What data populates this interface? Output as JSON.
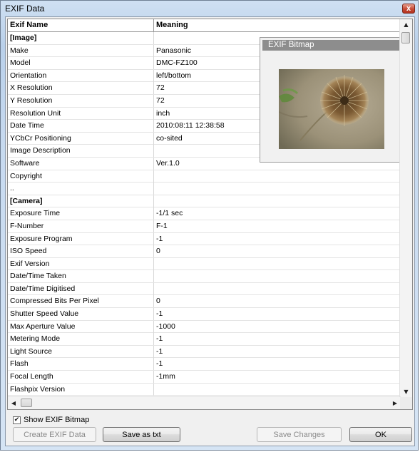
{
  "window": {
    "title": "EXIF Data",
    "close_glyph": "x"
  },
  "table": {
    "headers": {
      "name": "Exif Name",
      "meaning": "Meaning"
    },
    "rows": [
      {
        "name": "[Image]",
        "value": "",
        "section": true
      },
      {
        "name": "Make",
        "value": "Panasonic"
      },
      {
        "name": "Model",
        "value": "DMC-FZ100"
      },
      {
        "name": "Orientation",
        "value": "left/bottom"
      },
      {
        "name": "X Resolution",
        "value": "72"
      },
      {
        "name": "Y Resolution",
        "value": "72"
      },
      {
        "name": "Resolution Unit",
        "value": "inch"
      },
      {
        "name": "Date Time",
        "value": "2010:08:11 12:38:58"
      },
      {
        "name": "YCbCr Positioning",
        "value": "co-sited"
      },
      {
        "name": "Image Description",
        "value": ""
      },
      {
        "name": "Software",
        "value": "Ver.1.0"
      },
      {
        "name": "Copyright",
        "value": ""
      },
      {
        "name": "..",
        "value": ""
      },
      {
        "name": "[Camera]",
        "value": "",
        "section": true
      },
      {
        "name": "Exposure Time",
        "value": "-1/1 sec"
      },
      {
        "name": "F-Number",
        "value": "F-1"
      },
      {
        "name": "Exposure Program",
        "value": "-1"
      },
      {
        "name": "ISO Speed",
        "value": "0"
      },
      {
        "name": "Exif Version",
        "value": ""
      },
      {
        "name": "Date/Time Taken",
        "value": ""
      },
      {
        "name": "Date/Time Digitised",
        "value": ""
      },
      {
        "name": "Compressed Bits Per Pixel",
        "value": "0"
      },
      {
        "name": "Shutter Speed Value",
        "value": "-1"
      },
      {
        "name": "Max Aperture Value",
        "value": "-1000"
      },
      {
        "name": "Metering Mode",
        "value": "-1"
      },
      {
        "name": "Light Source",
        "value": "-1"
      },
      {
        "name": "Flash",
        "value": "-1"
      },
      {
        "name": "Focal Length",
        "value": "-1mm"
      },
      {
        "name": "Flashpix Version",
        "value": ""
      }
    ]
  },
  "bitmap": {
    "title": "EXIF Bitmap"
  },
  "scroll": {
    "up": "▲",
    "down": "▼",
    "left": "◀",
    "right": "▶"
  },
  "options": {
    "show_bitmap_label": "Show EXIF Bitmap",
    "show_bitmap_checked": true,
    "check_glyph": "✔"
  },
  "buttons": {
    "create": "Create EXIF Data",
    "save_txt": "Save as txt",
    "save_changes": "Save Changes",
    "ok": "OK"
  }
}
